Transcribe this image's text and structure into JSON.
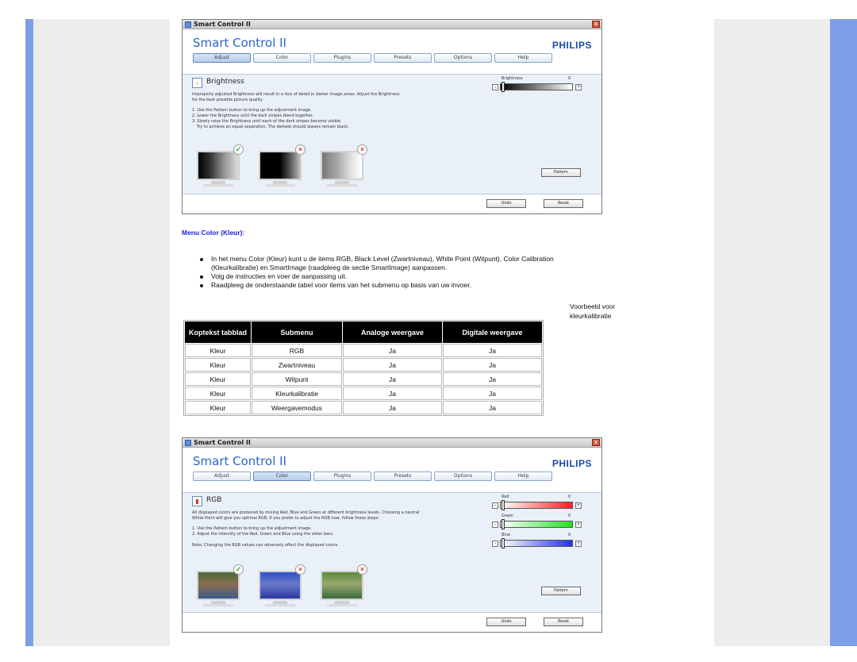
{
  "window_top": {
    "titlebar": "Smart Control II",
    "app_title": "Smart Control II",
    "brand": "PHILIPS",
    "tabs": [
      "Adjust",
      "Color",
      "PlugIns",
      "Presets",
      "Options",
      "Help"
    ],
    "section_title": "Brightness",
    "desc_line1": "Improperly adjusted Brightness will result in a loss of detail in darker image areas. Adjust the Brightness",
    "desc_line2": "for the best possible picture quality.",
    "step1": "1. Use the Pattern button to bring up the adjustment image.",
    "step2": "2. Lower the Brightness until the dark stripes blend together.",
    "step3": "3. Slowly raise the Brightness until each of the dark stripes become visible.",
    "step4": "Try to achieve an equal separation. The darkest should always remain black.",
    "slider_label": "Brightness",
    "slider_value": "0",
    "pattern_button": "Pattern",
    "undo_button": "Undo",
    "reset_button": "Reset"
  },
  "heading": "Menu Color (Kleur):",
  "bullets": [
    "In het menu Color (Kleur) kunt u de items RGB, Black Level (Zwartniveau), White Point (Witpunt), Color Calibration (Kleurkalibratie) en SmartImage (raadpleeg de sectie SmartImage) aanpassen.",
    "Volg de instructies en voer de aanpassing uit.",
    "Raadpleeg de onderstaande tabel voor items van het submenu op basis van uw invoer."
  ],
  "caption": {
    "line1": "Voorbeeld voor",
    "line2": "kleurkalibratie"
  },
  "table": {
    "headers": [
      "Koptekst tabblad",
      "Submenu",
      "Analoge weergave",
      "Digitale weergave"
    ],
    "rows": [
      [
        "Kleur",
        "RGB",
        "Ja",
        "Ja"
      ],
      [
        "Kleur",
        "Zwartniveau",
        "Ja",
        "Ja"
      ],
      [
        "Kleur",
        "Witpunt",
        "Ja",
        "Ja"
      ],
      [
        "Kleur",
        "Kleurkalibratie",
        "Ja",
        "Ja"
      ],
      [
        "Kleur",
        "Weergavemodus",
        "Ja",
        "Ja"
      ]
    ]
  },
  "window_bottom": {
    "titlebar": "Smart Control II",
    "app_title": "Smart Control II",
    "brand": "PHILIPS",
    "tabs": [
      "Adjust",
      "Color",
      "PlugIns",
      "Presets",
      "Options",
      "Help"
    ],
    "section_title": "RGB",
    "desc_line1": "All displayed colors are produced by mixing Red, Blue and Green at different brightness levels. Choosing a neutral",
    "desc_line2": "White Point will give you optimal RGB. If you prefer to adjust the RGB now, follow these steps:",
    "step1": "1. Use the Pattern button to bring up the adjustment image.",
    "step2": "2. Adjust the intensity of the Red, Green and Blue using the slider bars.",
    "note": "Note: Changing the RGB values can adversely affect the displayed colors.",
    "sliders": [
      {
        "label": "Red",
        "value": "0"
      },
      {
        "label": "Green",
        "value": "0"
      },
      {
        "label": "Blue",
        "value": "0"
      }
    ],
    "pattern_button": "Pattern",
    "undo_button": "Undo",
    "reset_button": "Reset"
  },
  "colors": {
    "side_stripe": "#7f9ee8",
    "gutter": "#ededed",
    "heading": "#1a22d8",
    "brand": "#1a4aa8"
  }
}
